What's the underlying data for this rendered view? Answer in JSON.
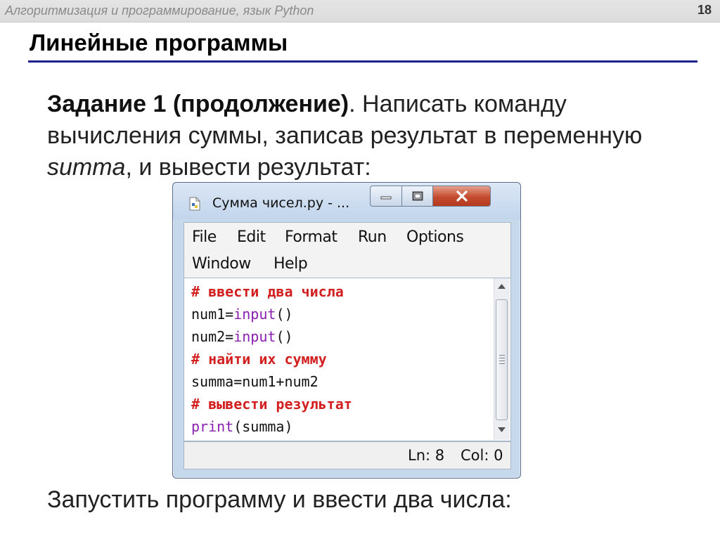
{
  "slide": {
    "course": "Алгоритмизация и программирование, язык Python",
    "page_number": "18",
    "title": "Линейные программы",
    "task_label": "Задание 1 (продолжение)",
    "task_text_1": ". Написать команду вычисления суммы, записав результат в переменную ",
    "task_var": "summa",
    "task_text_2": ", и вывести результат:",
    "bottom_text": "Запустить программу и ввести два числа:"
  },
  "window": {
    "title": "Сумма чисел.py - ...",
    "menu": [
      "File",
      "Edit",
      "Format",
      "Run",
      "Options",
      "Window",
      "Help"
    ],
    "code": [
      {
        "text": "# ввести два числа",
        "type": "comment"
      },
      {
        "pre": "num1=",
        "kw": "input",
        "post": "()"
      },
      {
        "pre": "num2=",
        "kw": "input",
        "post": "()"
      },
      {
        "text": "# найти их сумму",
        "type": "comment"
      },
      {
        "text": "summa=num1+num2",
        "type": "plain"
      },
      {
        "text": "# вывести результат",
        "type": "comment"
      },
      {
        "pre": "",
        "kw": "print",
        "post": "(summa)"
      }
    ],
    "status_ln": "Ln: 8",
    "status_col": "Col: 0"
  },
  "colors": {
    "title_rule": "#1f1f8c",
    "comment": "#d21f1f",
    "keyword": "#8a1fb0"
  }
}
